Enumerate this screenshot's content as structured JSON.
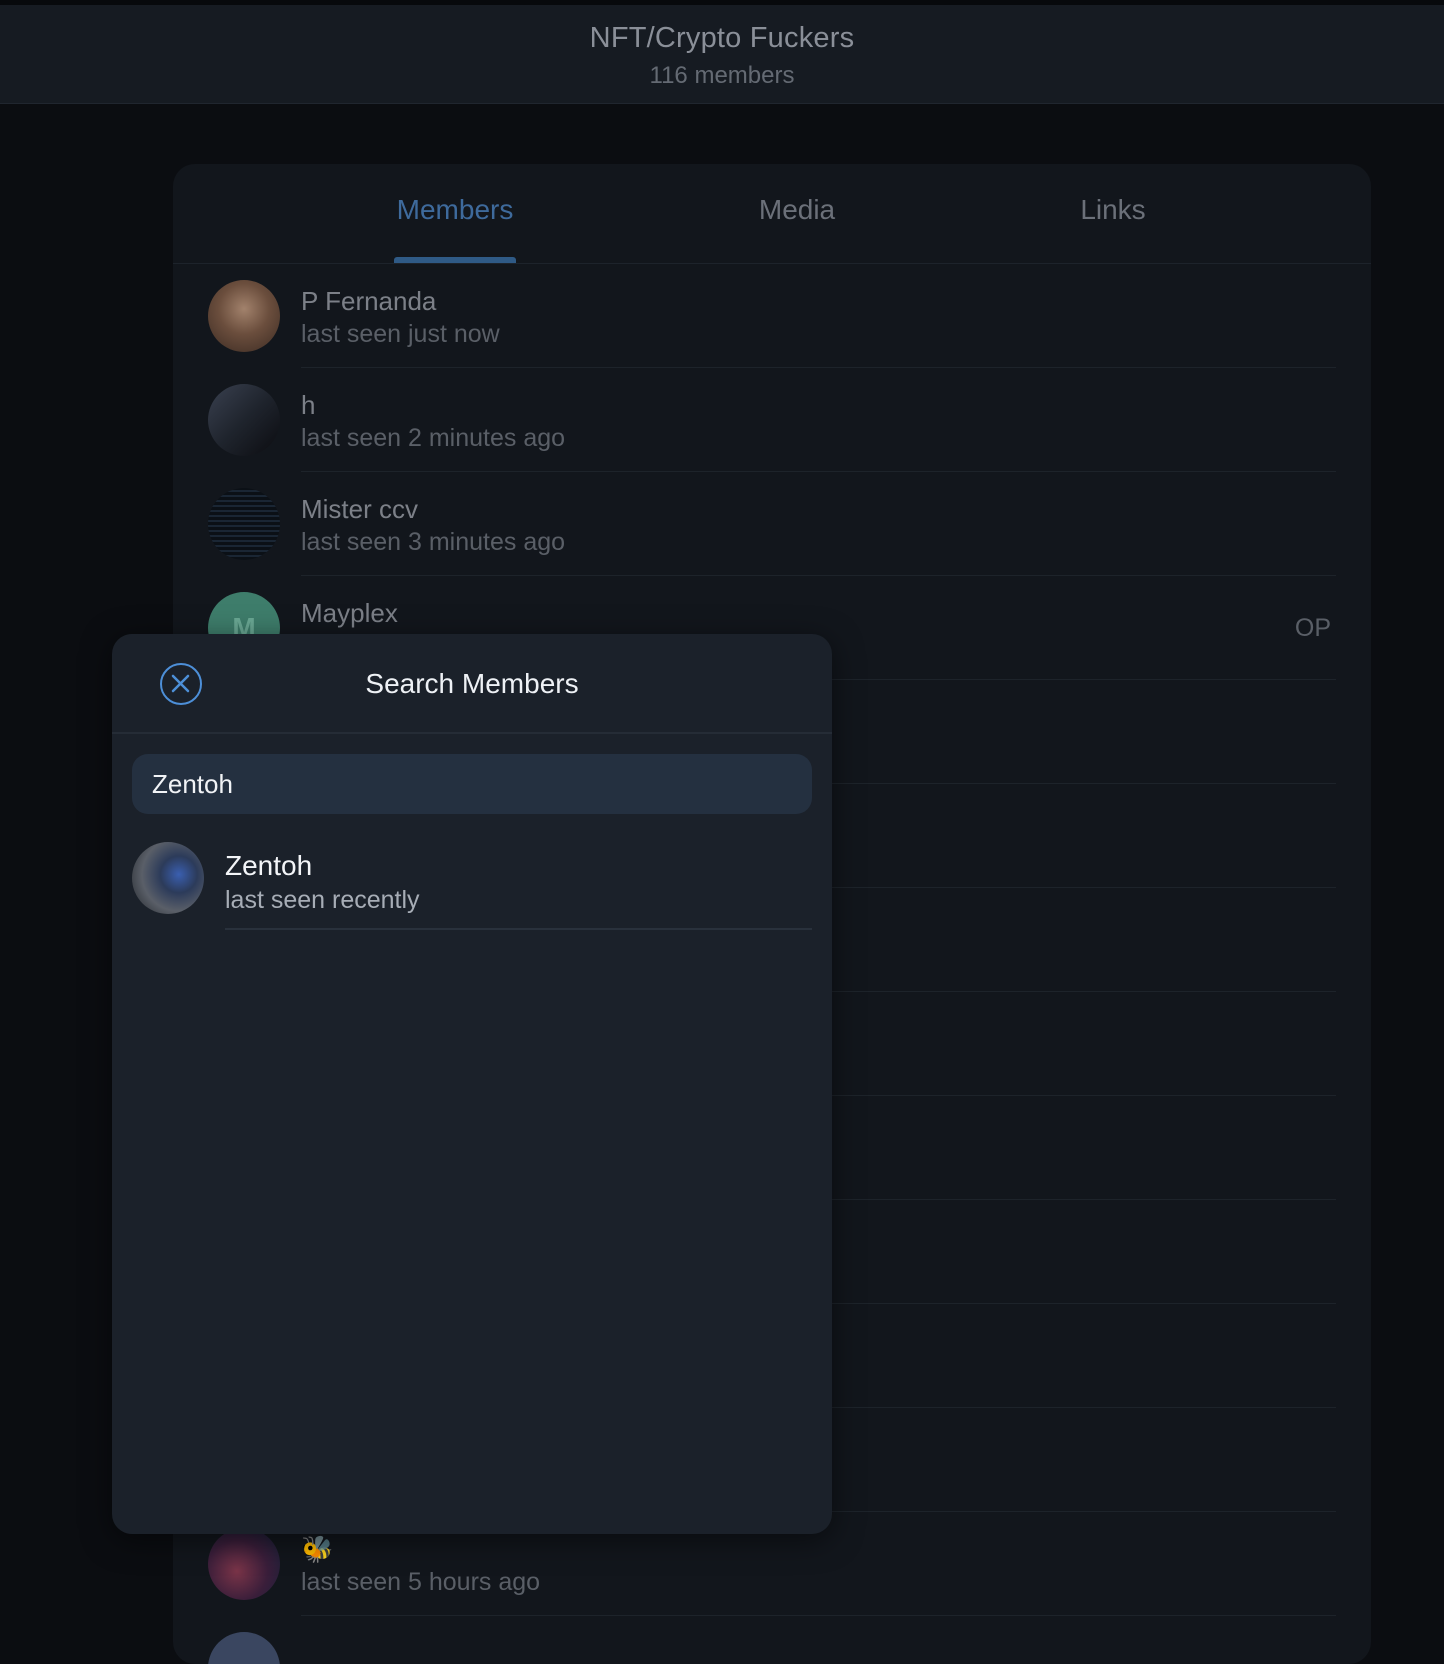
{
  "header": {
    "group_name": "NFT/Crypto Fuckers",
    "member_count": "116 members"
  },
  "tabs": [
    {
      "label": "Members",
      "active": true
    },
    {
      "label": "Media",
      "active": false
    },
    {
      "label": "Links",
      "active": false
    }
  ],
  "members": [
    {
      "name": "P Fernanda",
      "status": "last seen just now",
      "role": ""
    },
    {
      "name": "h",
      "status": "last seen 2 minutes ago",
      "role": ""
    },
    {
      "name": "Mister ccv",
      "status": "last seen 3 minutes ago",
      "role": ""
    },
    {
      "name": "Mayplex",
      "status": "",
      "role": "OP",
      "avatar_initial": "M"
    },
    {
      "name": "🐝",
      "status": "last seen 5 hours ago",
      "role": ""
    }
  ],
  "search_modal": {
    "title": "Search Members",
    "close_icon": "close-circle-icon",
    "query": "Zentoh",
    "results": [
      {
        "name": "Zentoh",
        "status": "last seen recently"
      }
    ]
  },
  "colors": {
    "accent": "#4d8fd8",
    "background": "#0b0d11",
    "modal_bg": "#1b212a"
  }
}
